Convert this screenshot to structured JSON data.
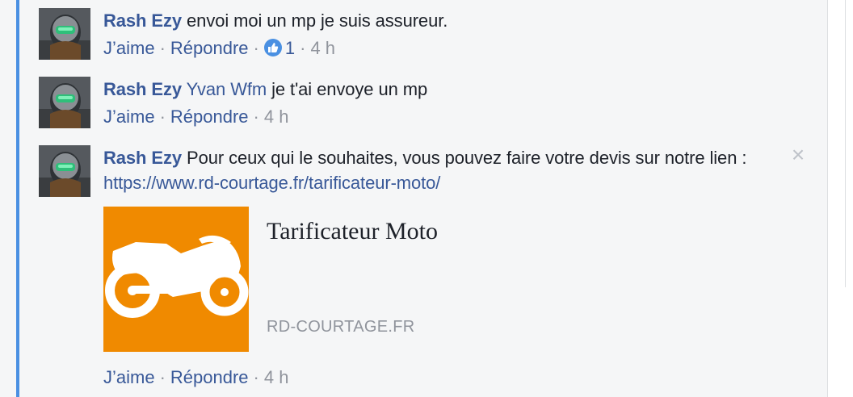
{
  "colors": {
    "thread_bar": "#4a90e2",
    "link": "#385898",
    "muted": "#90949c",
    "preview_bg": "#f08a00"
  },
  "comments": [
    {
      "author": "Rash Ezy",
      "text": " envoi moi un mp je suis assureur.",
      "actions": {
        "like": "J’aime",
        "reply": "Répondre",
        "reaction_count": "1",
        "time": "4 h"
      }
    },
    {
      "author": "Rash Ezy",
      "mention": "Yvan Wfm",
      "text": " je t'ai envoye un mp",
      "actions": {
        "like": "J’aime",
        "reply": "Répondre",
        "time": "4 h"
      }
    },
    {
      "author": "Rash Ezy",
      "text": " Pour ceux qui le souhaites, vous pouvez faire votre devis sur notre lien : ",
      "link": "https://www.rd-courtage.fr/tarificateur-moto/",
      "preview": {
        "title": "Tarificateur Moto",
        "domain": "RD-COURTAGE.FR",
        "image_icon": "motorcycle-icon"
      },
      "actions": {
        "like": "J’aime",
        "reply": "Répondre",
        "time": "4 h"
      }
    }
  ],
  "close_icon": "×",
  "sep": "·"
}
